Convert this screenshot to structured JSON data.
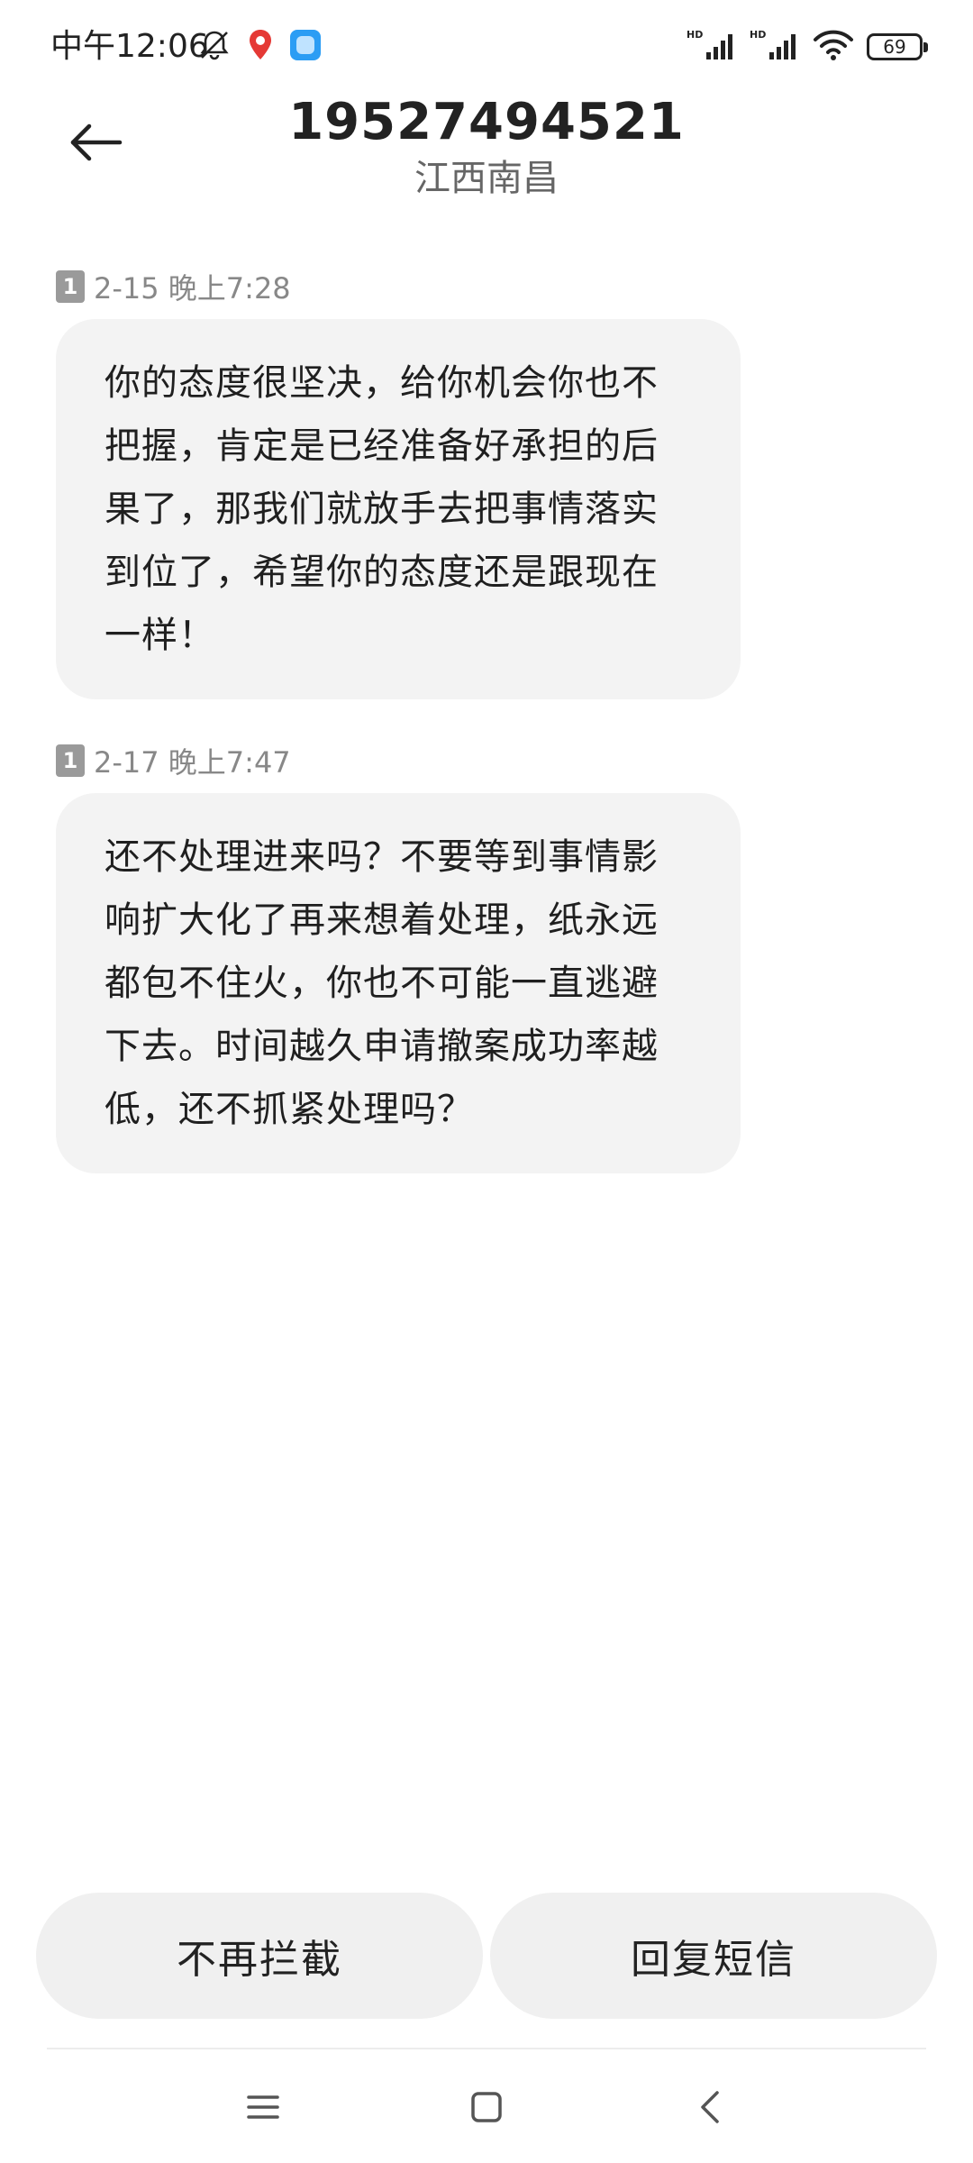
{
  "status_bar": {
    "time": "中午12:06",
    "battery": "69",
    "left_icons": [
      "mute-bell-icon",
      "map-pin-icon",
      "app-icon"
    ],
    "right_icons": [
      "hd-signal-icon",
      "hd-signal-icon",
      "wifi-icon",
      "battery-icon"
    ]
  },
  "header": {
    "number": "19527494521",
    "location": "江西南昌",
    "back_icon": "arrow-left-icon"
  },
  "messages": [
    {
      "sim": "1",
      "timestamp": "2-15 晚上7:28",
      "text": "你的态度很坚决，给你机会你也不把握，肯定是已经准备好承担的后果了，那我们就放手去把事情落实到位了，希望你的态度还是跟现在一样！"
    },
    {
      "sim": "1",
      "timestamp": "2-17 晚上7:47",
      "text": "还不处理进来吗？不要等到事情影响扩大化了再来想着处理，纸永远都包不住火，你也不可能一直逃避下去。时间越久申请撤案成功率越低，还不抓紧处理吗？"
    }
  ],
  "actions": {
    "unblock_label": "不再拦截",
    "reply_label": "回复短信"
  },
  "nav_bar": {
    "icons": [
      "menu-icon",
      "home-square-icon",
      "back-chevron-icon"
    ]
  },
  "colors": {
    "bubble_bg": "#f3f3f3",
    "button_bg": "#f0f0f0",
    "meta_text": "#888888"
  }
}
